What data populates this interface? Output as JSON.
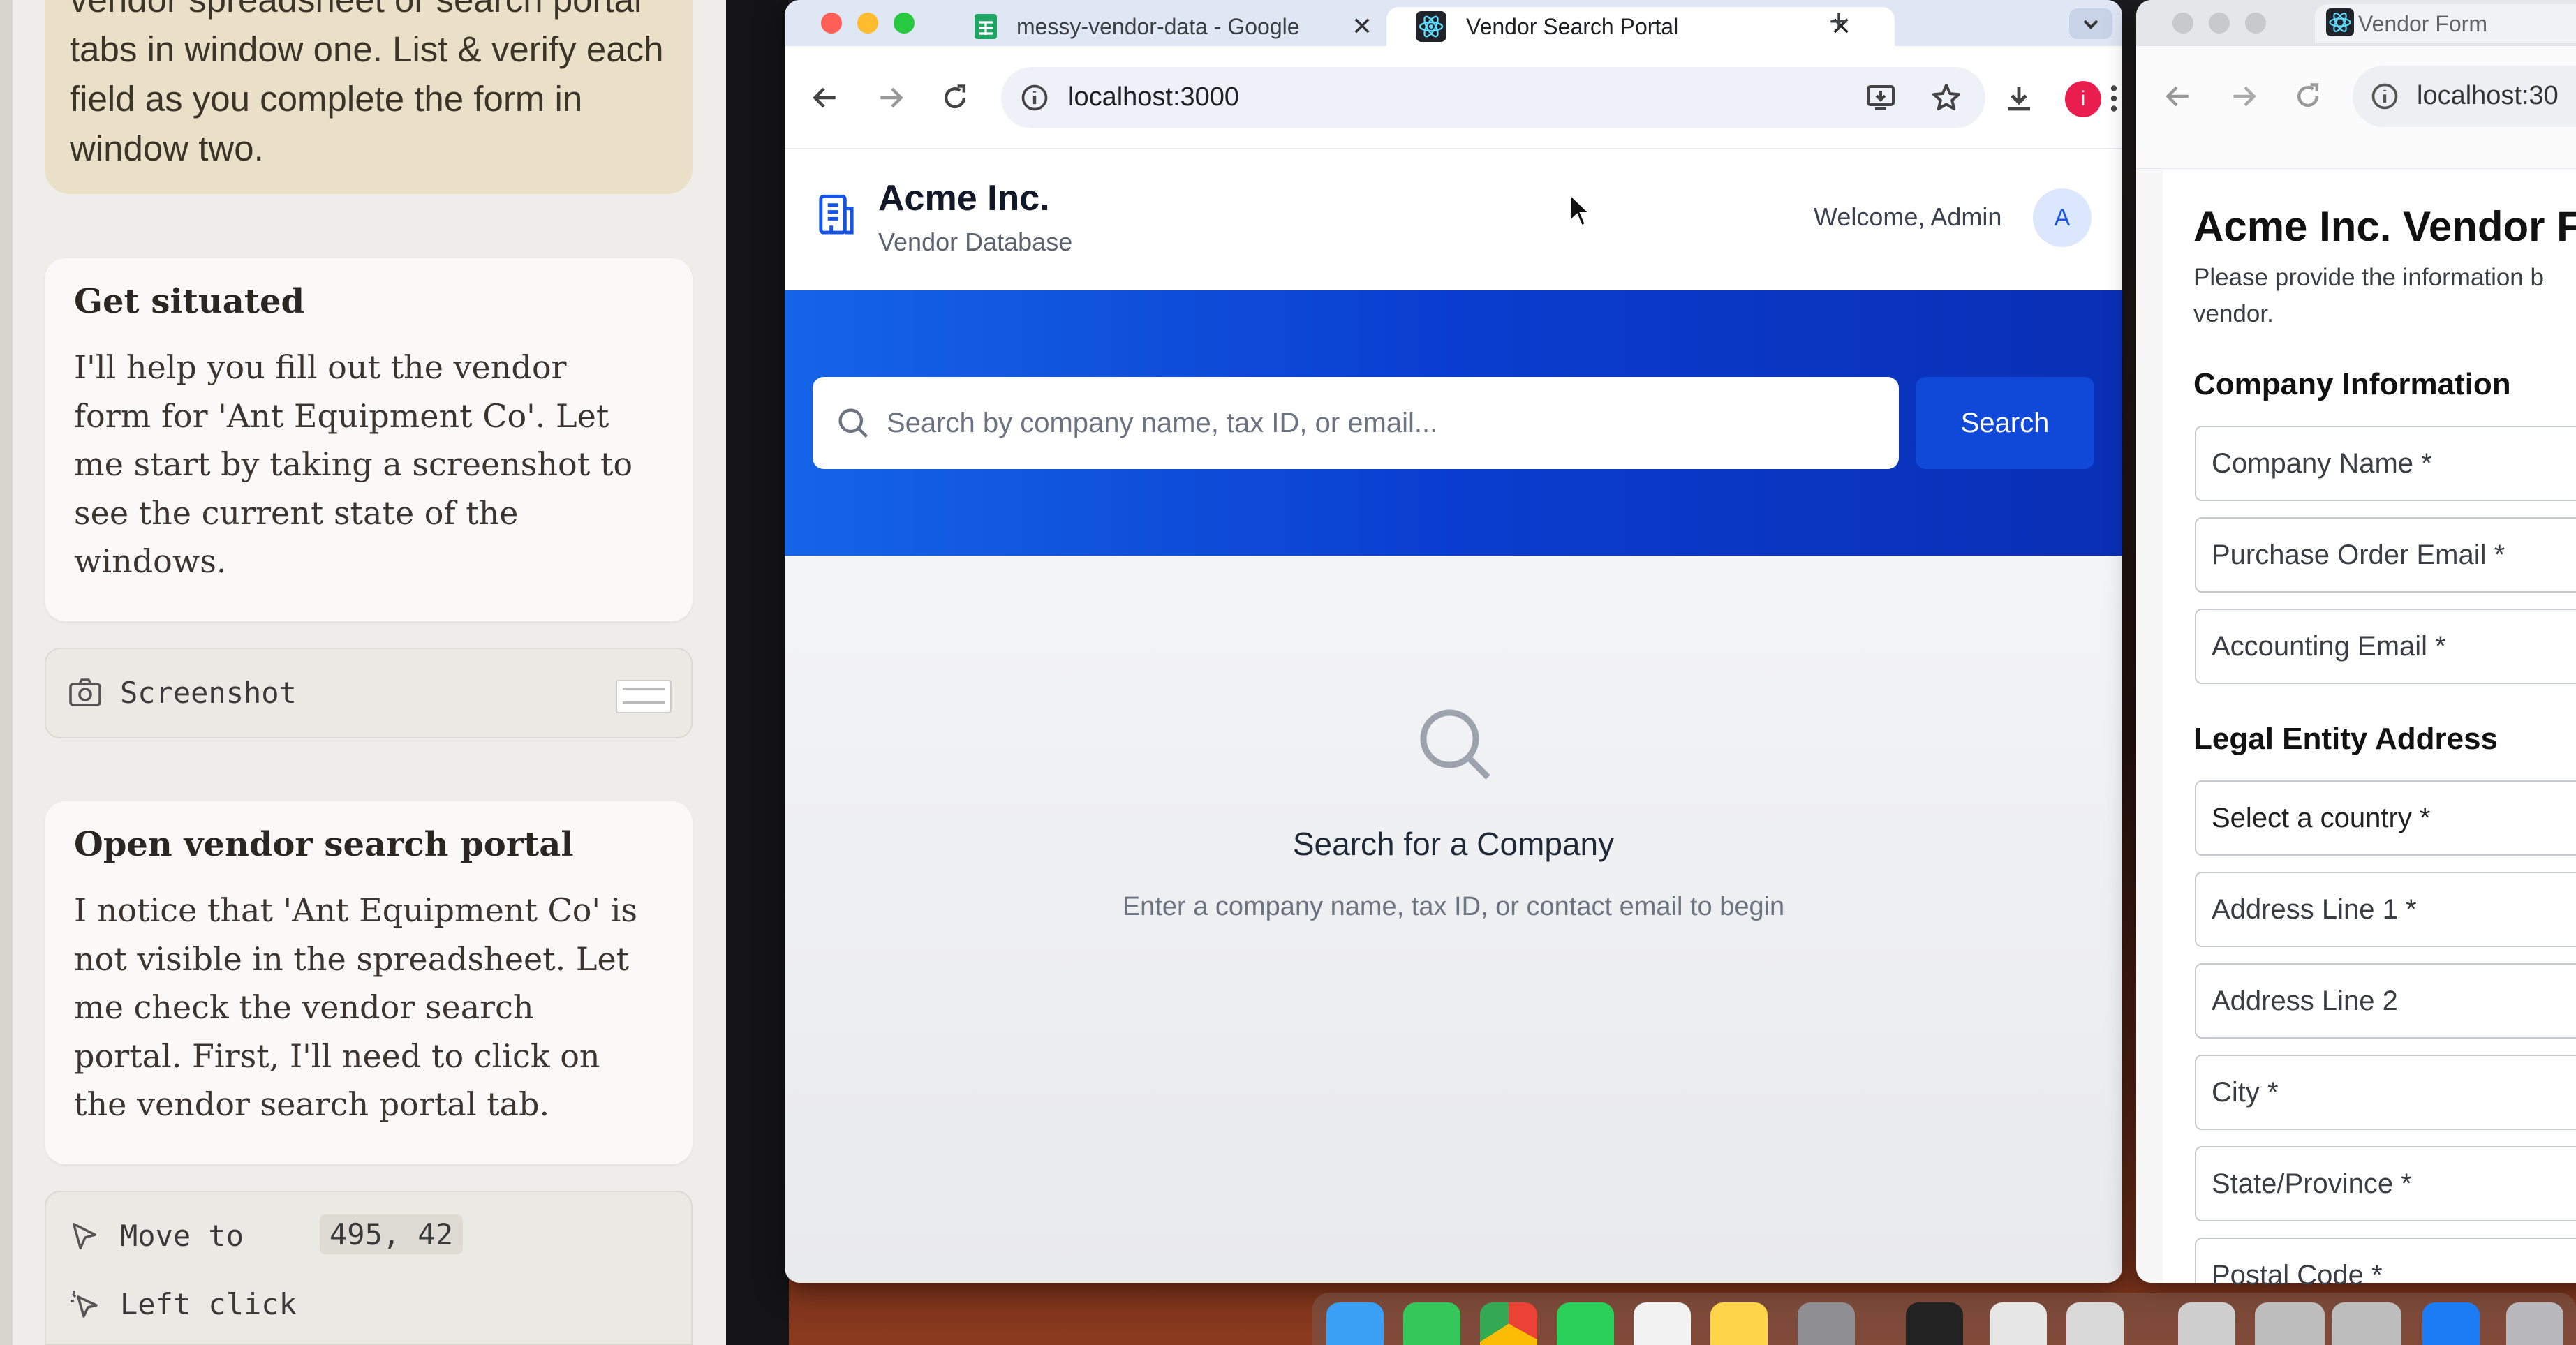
{
  "assistant": {
    "intro_text": "vendor spreadsheet or search portal tabs in window one. List & verify each field as you complete the form in window two.",
    "steps": [
      {
        "title": "Get situated",
        "body": "I'll help you fill out the vendor form for 'Ant Equipment Co'. Let me start by taking a screenshot to see the current state of the windows."
      },
      {
        "title": "Open vendor search portal",
        "body": "I notice that 'Ant Equipment Co' is not visible in the spreadsheet. Let me check the vendor search portal. First, I'll need to click on the vendor search portal tab."
      }
    ],
    "screenshot_action": {
      "label": "Screenshot",
      "icon": "camera-icon"
    },
    "actions": [
      {
        "label": "Move to",
        "value": "495, 42",
        "icon": "cursor-icon"
      },
      {
        "label": "Left click",
        "icon": "click-icon"
      }
    ]
  },
  "browser_main": {
    "tabs": [
      {
        "title": "messy-vendor-data - Google",
        "icon": "sheets-icon",
        "active": false
      },
      {
        "title": "Vendor Search Portal",
        "icon": "react-icon",
        "active": true
      }
    ],
    "new_tab_label": "+",
    "url": "localhost:3000",
    "app": {
      "brand_name": "Acme Inc.",
      "brand_subtitle": "Vendor Database",
      "welcome_text": "Welcome, Admin",
      "avatar_letter": "A",
      "search_placeholder": "Search by company name, tax ID, or email...",
      "search_button": "Search",
      "empty_title": "Search for a Company",
      "empty_subtitle": "Enter a company name, tax ID, or contact email to begin"
    }
  },
  "browser_form": {
    "tab_title": "Vendor Form",
    "url": "localhost:30",
    "form": {
      "title": "Acme Inc. Vendor F",
      "description": "Please provide the information b vendor.",
      "section_company": "Company Information",
      "company_fields": [
        "Company Name *",
        "Purchase Order Email *",
        "Accounting Email *"
      ],
      "section_address": "Legal Entity Address",
      "address_fields": [
        "Select a country *",
        "Address Line 1 *",
        "Address Line 2",
        "City *",
        "State/Province *",
        "Postal Code *"
      ]
    }
  },
  "colors": {
    "accent_blue": "#0a3dcf",
    "search_button": "#1048d8",
    "profile_red": "#e91e4f"
  }
}
